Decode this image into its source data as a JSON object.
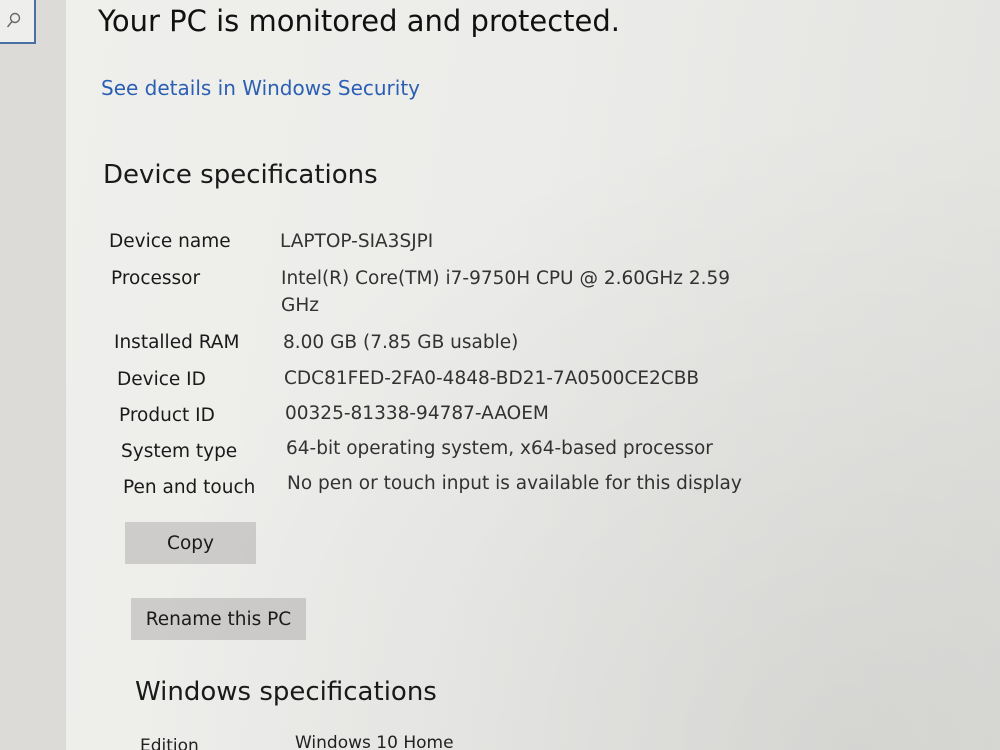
{
  "search": {
    "icon": "search-icon"
  },
  "security": {
    "status": "Your PC is monitored and protected.",
    "link": "See details in Windows Security"
  },
  "device_specs": {
    "title": "Device specifications",
    "rows": [
      {
        "label": "Device name",
        "value": "LAPTOP-SIA3SJPI"
      },
      {
        "label": "Processor",
        "value": "Intel(R) Core(TM) i7-9750H CPU @ 2.60GHz   2.59",
        "value_cont": "GHz"
      },
      {
        "label": "Installed RAM",
        "value": "8.00 GB (7.85 GB usable)"
      },
      {
        "label": "Device ID",
        "value": "CDC81FED-2FA0-4848-BD21-7A0500CE2CBB"
      },
      {
        "label": "Product ID",
        "value": "00325-81338-94787-AAOEM"
      },
      {
        "label": "System type",
        "value": "64-bit operating system, x64-based processor"
      },
      {
        "label": "Pen and touch",
        "value": "No pen or touch input is available for this display"
      }
    ],
    "copy_label": "Copy",
    "rename_label": "Rename this PC"
  },
  "windows_specs": {
    "title": "Windows specifications",
    "rows": [
      {
        "label": "Edition",
        "value": "Windows 10 Home"
      }
    ]
  },
  "colors": {
    "link": "#2b5fb3",
    "button_bg": "#cdccca",
    "search_border": "#4a6fa5"
  }
}
